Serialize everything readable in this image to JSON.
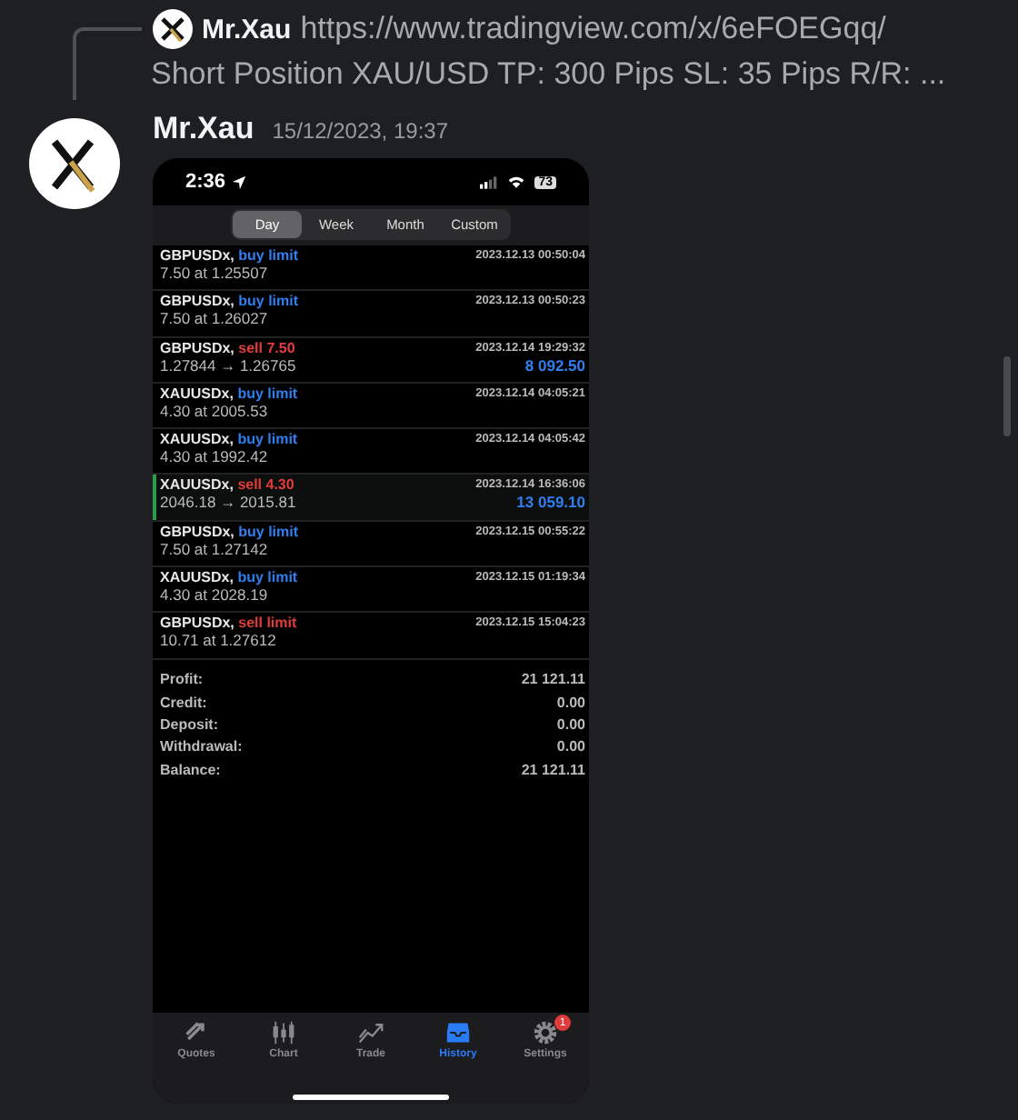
{
  "reply": {
    "author": "Mr.Xau",
    "link": "https://www.tradingview.com/x/6eFOEGqq/",
    "text": "Short Position XAU/USD TP: 300 Pips SL: 35 Pips R/R: ..."
  },
  "message": {
    "author": "Mr.Xau",
    "timestamp": "15/12/2023, 19:37"
  },
  "phone": {
    "status_bar": {
      "time": "2:36",
      "battery": "73"
    },
    "periods": [
      {
        "label": "Day",
        "selected": true
      },
      {
        "label": "Week",
        "selected": false
      },
      {
        "label": "Month",
        "selected": false
      },
      {
        "label": "Custom",
        "selected": false
      }
    ],
    "orders": [
      {
        "symbol": "GBPUSDx,",
        "action": "buy limit",
        "kind": "buy",
        "time": "2023.12.13 00:50:04",
        "detail": "7.50 at 1.25507",
        "selected": false
      },
      {
        "symbol": "GBPUSDx,",
        "action": "buy limit",
        "kind": "buy",
        "time": "2023.12.13 00:50:23",
        "detail": "7.50 at 1.26027",
        "selected": false
      },
      {
        "symbol": "GBPUSDx,",
        "action": "sell 7.50",
        "kind": "sell",
        "time": "2023.12.14 19:29:32",
        "detail": "1.27844 → 1.26765",
        "profit": "8 092.50",
        "selected": false
      },
      {
        "symbol": "XAUUSDx,",
        "action": "buy limit",
        "kind": "buy",
        "time": "2023.12.14 04:05:21",
        "detail": "4.30 at 2005.53",
        "selected": false
      },
      {
        "symbol": "XAUUSDx,",
        "action": "buy limit",
        "kind": "buy",
        "time": "2023.12.14 04:05:42",
        "detail": "4.30 at 1992.42",
        "selected": false
      },
      {
        "symbol": "XAUUSDx,",
        "action": "sell 4.30",
        "kind": "sell",
        "time": "2023.12.14 16:36:06",
        "detail": "2046.18 → 2015.81",
        "profit": "13 059.10",
        "selected": true
      },
      {
        "symbol": "GBPUSDx,",
        "action": "buy limit",
        "kind": "buy",
        "time": "2023.12.15 00:55:22",
        "detail": "7.50 at 1.27142",
        "selected": false
      },
      {
        "symbol": "XAUUSDx,",
        "action": "buy limit",
        "kind": "buy",
        "time": "2023.12.15 01:19:34",
        "detail": "4.30 at 2028.19",
        "selected": false
      },
      {
        "symbol": "GBPUSDx,",
        "action": "sell limit",
        "kind": "sell",
        "time": "2023.12.15 15:04:23",
        "detail": "10.71 at 1.27612",
        "selected": false
      }
    ],
    "summary": [
      {
        "label": "Profit:",
        "value": "21 121.11"
      },
      {
        "label": "Credit:",
        "value": "0.00"
      },
      {
        "label": "Deposit:",
        "value": "0.00"
      },
      {
        "label": "Withdrawal:",
        "value": "0.00"
      },
      {
        "label": "Balance:",
        "value": "21 121.11"
      }
    ],
    "tabs": [
      {
        "label": "Quotes",
        "kind": "quotes",
        "selected": false
      },
      {
        "label": "Chart",
        "kind": "chart",
        "selected": false
      },
      {
        "label": "Trade",
        "kind": "trade",
        "selected": false
      },
      {
        "label": "History",
        "kind": "history",
        "selected": true
      },
      {
        "label": "Settings",
        "kind": "settings",
        "selected": false,
        "badge": "1"
      }
    ]
  }
}
